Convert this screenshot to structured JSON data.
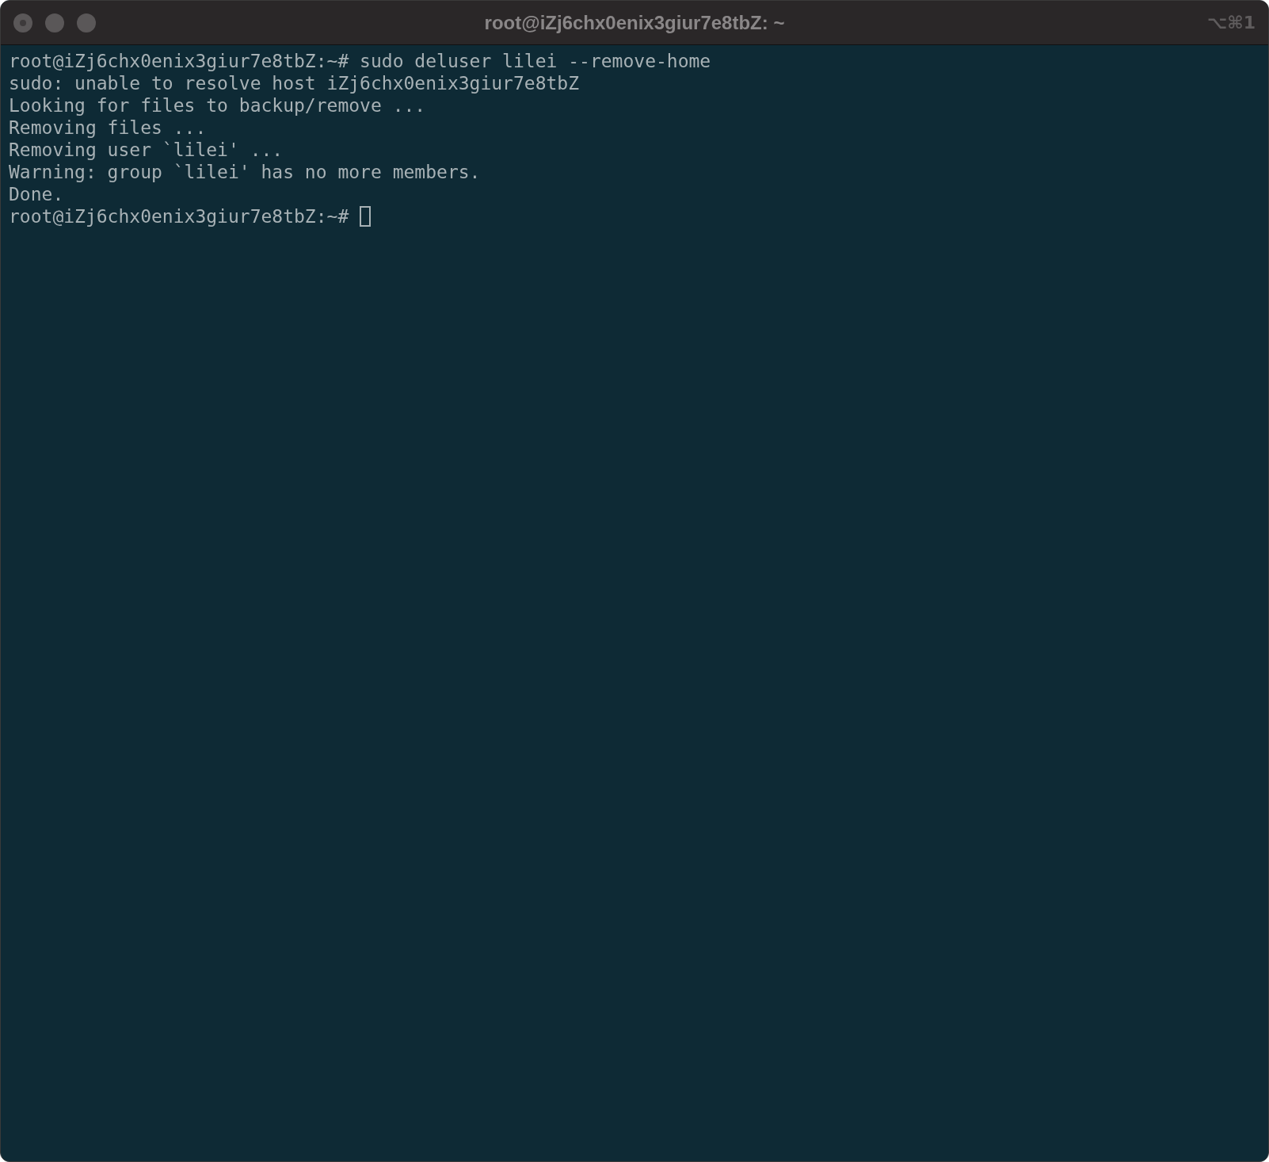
{
  "window": {
    "title": "root@iZj6chx0enix3giur7e8tbZ: ~",
    "shortcut": "⌥⌘1"
  },
  "terminal": {
    "lines": [
      {
        "text": "root@iZj6chx0enix3giur7e8tbZ:~# sudo deluser lilei --remove-home",
        "cursor": false
      },
      {
        "text": "sudo: unable to resolve host iZj6chx0enix3giur7e8tbZ",
        "cursor": false
      },
      {
        "text": "Looking for files to backup/remove ...",
        "cursor": false
      },
      {
        "text": "Removing files ...",
        "cursor": false
      },
      {
        "text": "Removing user `lilei' ...",
        "cursor": false
      },
      {
        "text": "Warning: group `lilei' has no more members.",
        "cursor": false
      },
      {
        "text": "Done.",
        "cursor": false
      },
      {
        "text": "root@iZj6chx0enix3giur7e8tbZ:~# ",
        "cursor": true
      }
    ]
  }
}
